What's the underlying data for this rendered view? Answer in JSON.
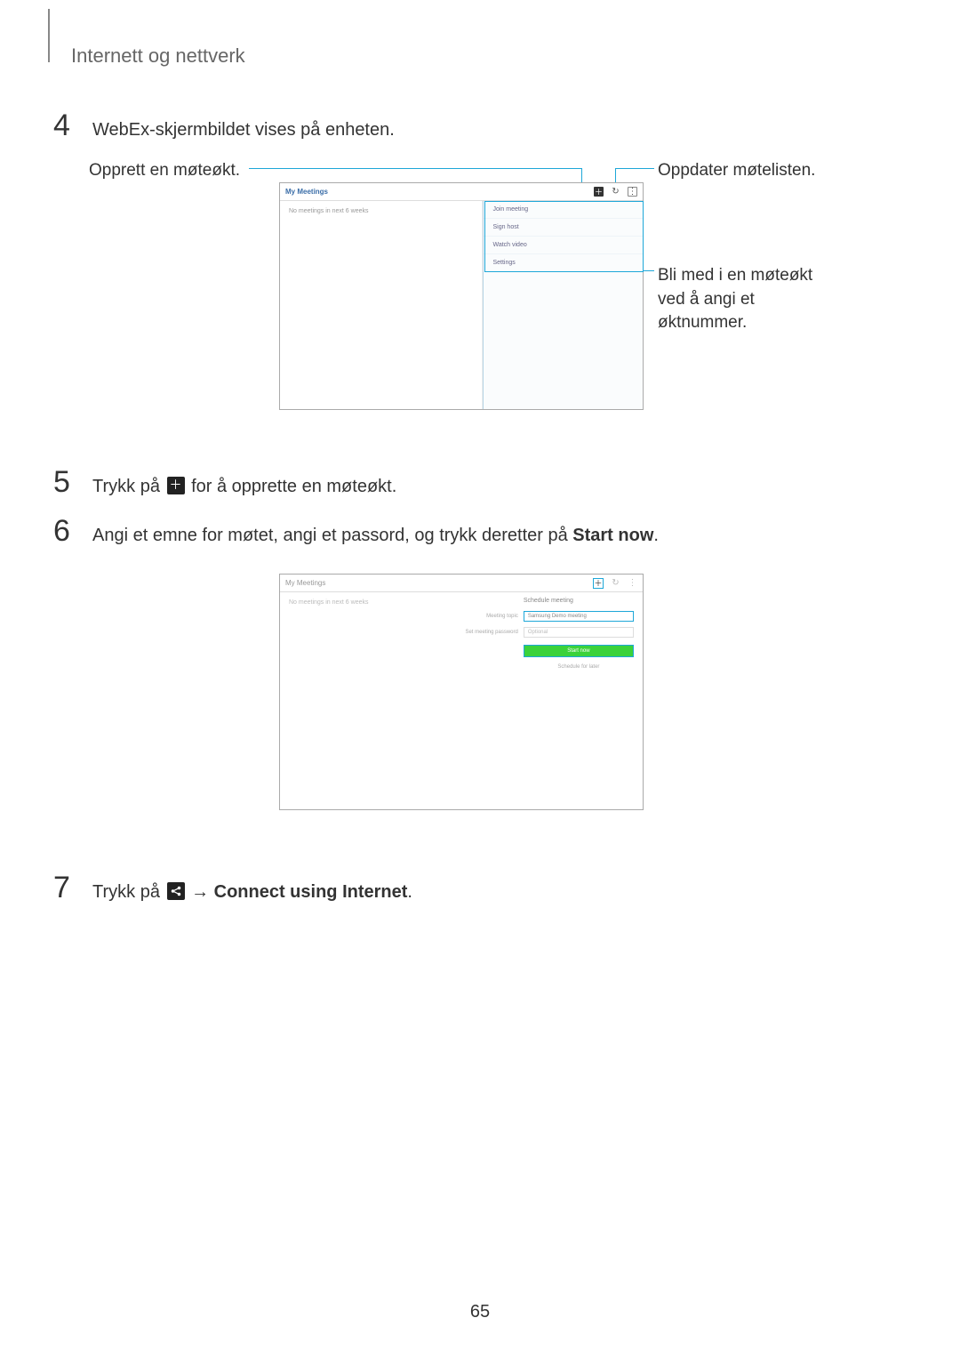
{
  "section_title": "Internett og nettverk",
  "steps": {
    "s4": {
      "num": "4",
      "text": "WebEx-skjermbildet vises på enheten."
    },
    "s5": {
      "num": "5",
      "pre": "Trykk på ",
      "post": " for å opprette en møteøkt."
    },
    "s6": {
      "num": "6",
      "pre": "Angi et emne for møtet, angi et passord, og trykk deretter på ",
      "bold": "Start now",
      "post": "."
    },
    "s7": {
      "num": "7",
      "pre": "Trykk på ",
      "arrow": " → ",
      "bold": "Connect using Internet",
      "post": "."
    }
  },
  "callouts": {
    "left": "Opprett en møteøkt.",
    "right_top": "Oppdater møtelisten.",
    "right_bottom": "Bli med i en møteøkt ved å angi et øktnummer."
  },
  "screenshot1": {
    "title": "My Meetings",
    "empty_text": "No meetings in next 6 weeks",
    "menu": [
      "Join meeting",
      "Sign host",
      "Watch video",
      "Settings"
    ]
  },
  "screenshot2": {
    "title": "My Meetings",
    "empty_text": "No meetings in next 6 weeks",
    "panel_heading": "Schedule meeting",
    "topic_label": "Meeting topic",
    "topic_value": "Samsung Demo meeting",
    "pw_label": "Set meeting password",
    "pw_value": "Optional",
    "start_button": "Start now",
    "schedule_link": "Schedule for later"
  },
  "page_number": "65",
  "icons": {
    "plus": "＋",
    "refresh": "↻",
    "more": "⋮",
    "share": "⎋"
  }
}
